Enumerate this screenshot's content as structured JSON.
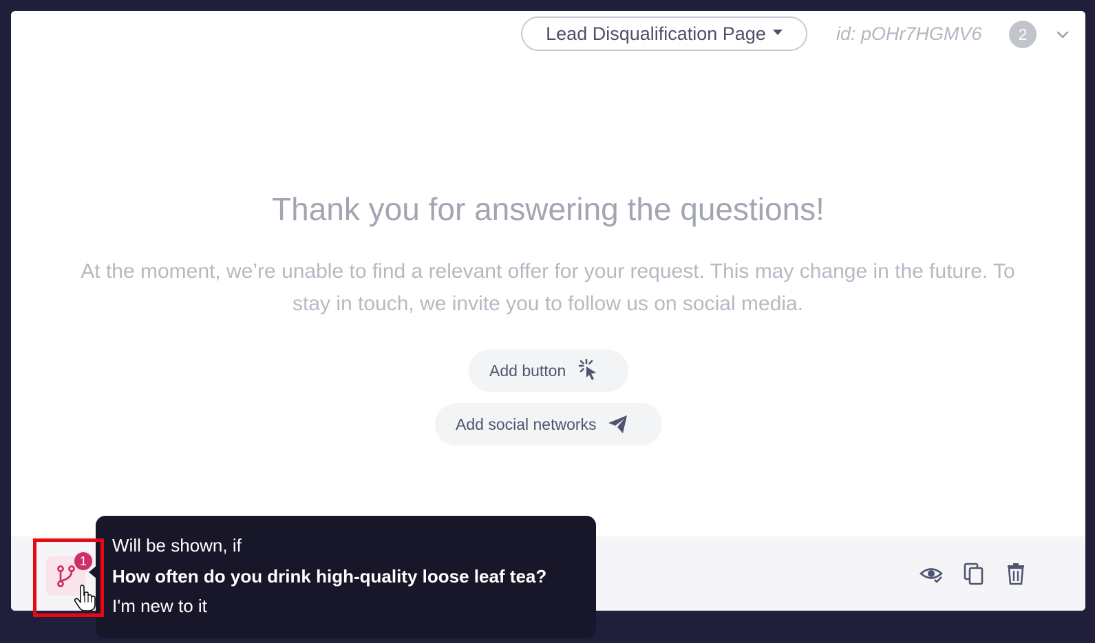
{
  "header": {
    "page_select_label": "Lead Disqualification Page",
    "page_id": "id: pOHr7HGMV6",
    "count_badge": "2"
  },
  "content": {
    "title": "Thank you for answering the questions!",
    "subtitle": "At the moment, we’re unable to find a relevant offer for your request. This may change in the future. To stay in touch, we invite you to follow us on social media.",
    "add_button_label": "Add button",
    "add_social_label": "Add social networks"
  },
  "condition": {
    "count": "1",
    "tooltip_heading": "Will be shown, if",
    "tooltip_question": "How often do you drink high-quality loose leaf tea?",
    "tooltip_answer": "I'm new to it"
  },
  "footer": {
    "icons": [
      "visibility-icon",
      "copy-icon",
      "delete-icon"
    ]
  },
  "colors": {
    "background": "#1f1f3b",
    "accent": "#cc2f6a",
    "highlight": "#e50914",
    "tooltip_bg": "#171729"
  }
}
